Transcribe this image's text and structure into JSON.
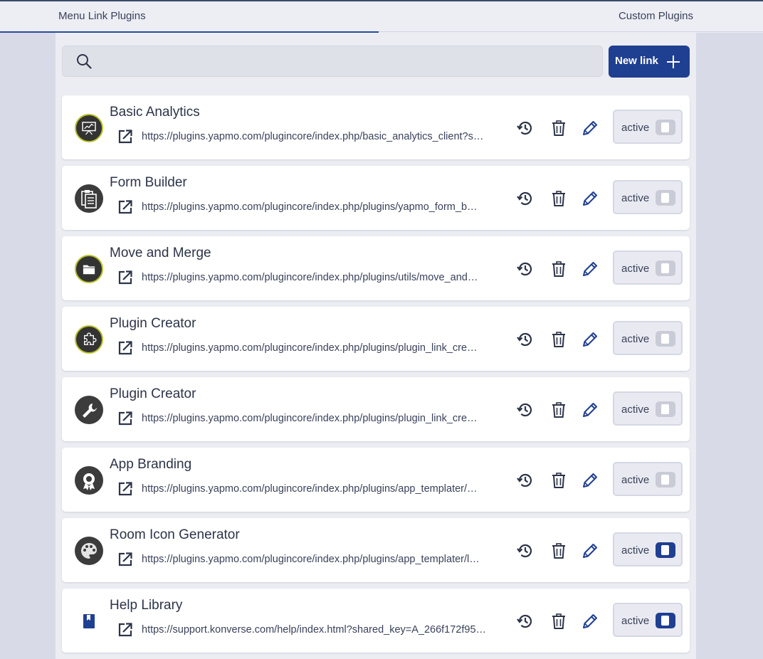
{
  "tabs": {
    "left": "Menu Link Plugins",
    "right": "Custom Plugins"
  },
  "search": {
    "placeholder": "",
    "value": ""
  },
  "new_link_label": "New link",
  "toggle_label": "active",
  "colors": {
    "primary": "#1f3f91",
    "ring": "#b9c22a"
  },
  "plugins": [
    {
      "title": "Basic Analytics",
      "url": "https://plugins.yapmo.com/plugincore/index.php/basic_analytics_client?s…",
      "icon": "presentation-chart-icon",
      "active": false
    },
    {
      "title": "Form Builder",
      "url": "https://plugins.yapmo.com/plugincore/index.php/plugins/yapmo_form_b…",
      "icon": "clipboard-form-icon",
      "active": false
    },
    {
      "title": "Move and Merge",
      "url": "https://plugins.yapmo.com/plugincore/index.php/plugins/utils/move_and…",
      "icon": "folder-icon",
      "active": false
    },
    {
      "title": "Plugin Creator",
      "url": "https://plugins.yapmo.com/plugincore/index.php/plugins/plugin_link_cre…",
      "icon": "puzzle-icon",
      "active": false
    },
    {
      "title": "Plugin Creator",
      "url": "https://plugins.yapmo.com/plugincore/index.php/plugins/plugin_link_cre…",
      "icon": "wrench-icon",
      "active": false
    },
    {
      "title": "App Branding",
      "url": "https://plugins.yapmo.com/plugincore/index.php/plugins/app_templater/…",
      "icon": "award-badge-icon",
      "active": false
    },
    {
      "title": "Room Icon Generator",
      "url": "https://plugins.yapmo.com/plugincore/index.php/plugins/app_templater/l…",
      "icon": "palette-icon",
      "active": true
    },
    {
      "title": "Help Library",
      "url": "https://support.konverse.com/help/index.html?shared_key=A_266f172f95…",
      "icon": "book-icon",
      "active": true
    }
  ]
}
